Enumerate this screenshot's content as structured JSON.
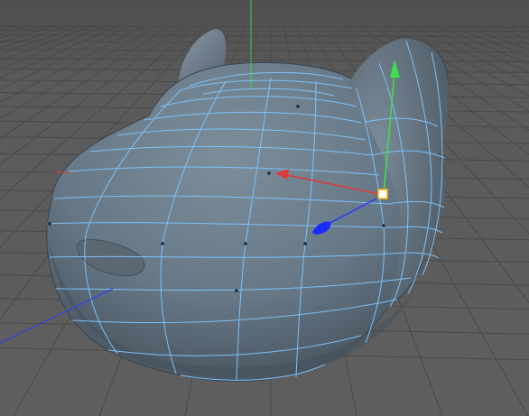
{
  "viewport": {
    "background_color": "#5a5a5a",
    "grid_color": "#4a4a4a",
    "grid_highlight_color": "#6a6a6a",
    "horizon_color": "#3c3c3c"
  },
  "model": {
    "surface_color": "#6f7f8c",
    "surface_dark_color": "#4f5b66",
    "wireframe_color": "#7fc6ff",
    "selected_vertex_color": "#ffffff"
  },
  "gizmo": {
    "x_axis_color": "#e23a3a",
    "y_axis_color": "#3fe04a",
    "z_axis_color": "#2a3cff",
    "center_color": "#ffb000"
  },
  "icons": {
    "move_gizmo": "move-gizmo-icon",
    "selected_vertex": "selected-vertex-icon"
  }
}
